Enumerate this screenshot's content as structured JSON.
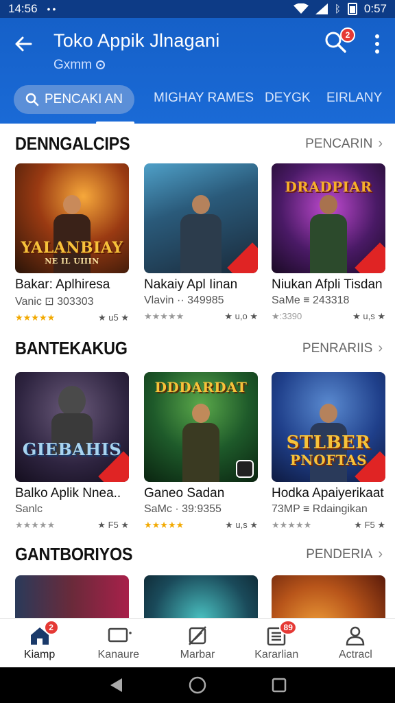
{
  "status_bar": {
    "time": "14:56",
    "dots": "••",
    "battery_text": "0:57"
  },
  "app_bar": {
    "title": "Toko Appik Jlnagani",
    "subtitle": "Gxmm",
    "search_badge": "2",
    "colors": {
      "primary": "#1560c8",
      "badge": "#e53935"
    }
  },
  "tabs": [
    {
      "label": "PENCAKI AN",
      "active": true
    },
    {
      "label": "MIGHAY RAMES",
      "active": false
    },
    {
      "label": "DEYGK",
      "active": false
    },
    {
      "label": "EIRLANY",
      "active": false
    }
  ],
  "sections": [
    {
      "title": "DENNGALCIPS",
      "more": "PENCARIN",
      "apps": [
        {
          "name": "Bakar: Aplhiresa",
          "sub": "Vanic ⊡ 303303",
          "stars": "★★★★★",
          "rating_end": "★ u5 ★",
          "art": "YALANBIAY",
          "art_sub": "NE IL UIIIN",
          "bg": "#7a2f12"
        },
        {
          "name": "Nakaiy Apl Iinan",
          "sub": "Vlavin ·· 349985",
          "stars": "★★★★★",
          "rating_end": "★ u,o ★",
          "art": "",
          "art_sub": "",
          "bg": "#1d4a66"
        },
        {
          "name": "Niukan Afpli Tisdan",
          "sub": "SaMe ≡ 243318",
          "stars": "★:3390",
          "rating_end": "★ u,s ★",
          "art": "DRADPIAR",
          "art_sub": "",
          "bg": "#4a1a66"
        }
      ]
    },
    {
      "title": "BANTEKAKUG",
      "more": "PENRARIIS",
      "apps": [
        {
          "name": "Balko Aplik Nnea..",
          "sub": "Sanlc",
          "stars": "★★★★★",
          "rating_end": "★ F5 ★",
          "art": "GIEBAHIS",
          "art_sub": "",
          "bg": "#3a2a52"
        },
        {
          "name": "Ganeo Sadan",
          "sub": "SaMc · 39:9355",
          "stars": "★★★★★",
          "rating_end": "★ u,s ★",
          "art": "DDDARDAT",
          "art_sub": "",
          "bg": "#1e5a2a"
        },
        {
          "name": "Hodka Apaiyerikaat",
          "sub": "73MP ≡ Rdaingikan",
          "stars": "★★★★★",
          "rating_end": "★ F5 ★",
          "art": "STLBER",
          "art_sub": "PNOFTAS",
          "bg": "#1f3f8a"
        }
      ]
    },
    {
      "title": "GANTBORIYOS",
      "more": "PENDERIA",
      "apps": [
        {
          "bg": "#5a1a1a"
        },
        {
          "bg": "#1a4a5a"
        },
        {
          "bg": "#b8551a"
        }
      ]
    }
  ],
  "bottom_nav": [
    {
      "label": "Kiamp",
      "icon": "home-icon",
      "badge": "2",
      "active": true
    },
    {
      "label": "Kanaure",
      "icon": "monitor-icon",
      "badge": "",
      "active": false
    },
    {
      "label": "Marbar",
      "icon": "no-edit-icon",
      "badge": "",
      "active": false
    },
    {
      "label": "Kararlian",
      "icon": "list-icon",
      "badge": "89",
      "active": false
    },
    {
      "label": "Actracl",
      "icon": "person-icon",
      "badge": "",
      "active": false
    }
  ]
}
